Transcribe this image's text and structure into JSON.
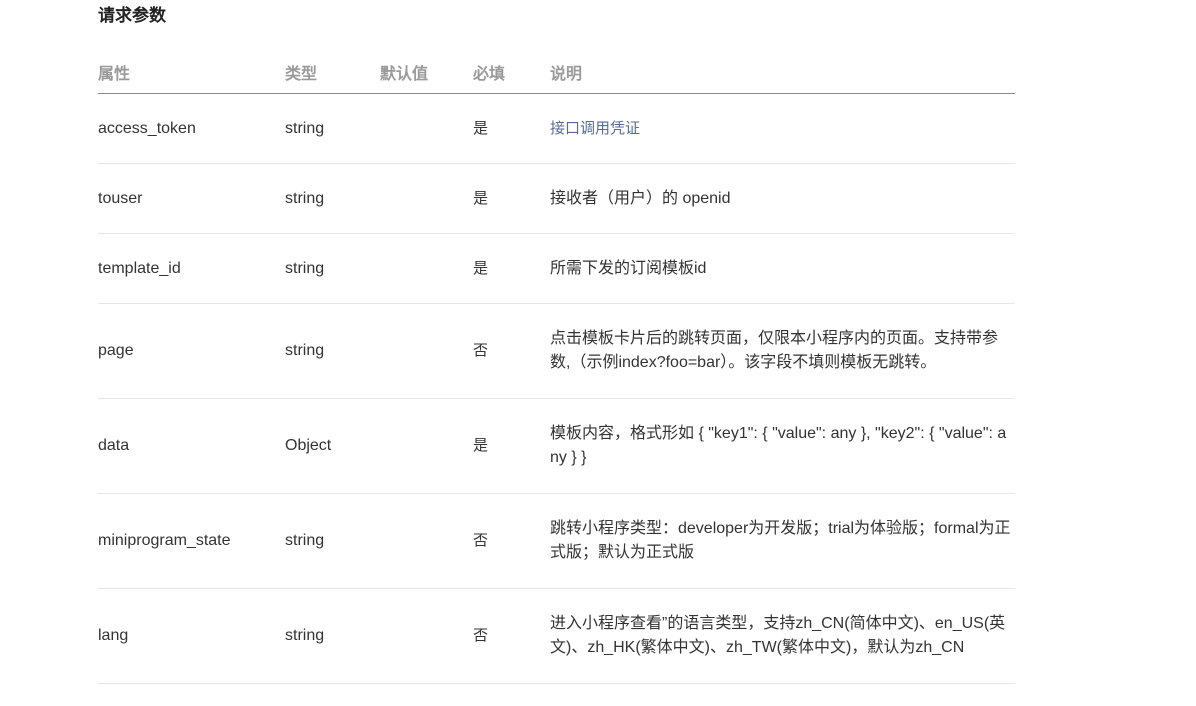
{
  "section": {
    "title": "请求参数"
  },
  "table": {
    "headers": {
      "name": "属性",
      "type": "类型",
      "default": "默认值",
      "required": "必填",
      "description": "说明"
    },
    "rows": [
      {
        "name": "access_token",
        "type": "string",
        "default": "",
        "required": "是",
        "description": "接口调用凭证"
      },
      {
        "name": "touser",
        "type": "string",
        "default": "",
        "required": "是",
        "description": "接收者（用户）的 openid"
      },
      {
        "name": "template_id",
        "type": "string",
        "default": "",
        "required": "是",
        "description": "所需下发的订阅模板id"
      },
      {
        "name": "page",
        "type": "string",
        "default": "",
        "required": "否",
        "description": "点击模板卡片后的跳转页面，仅限本小程序内的页面。支持带参数,（示例index?foo=bar）。该字段不填则模板无跳转。"
      },
      {
        "name": "data",
        "type": "Object",
        "default": "",
        "required": "是",
        "description": "模板内容，格式形如 { \"key1\": { \"value\": any }, \"key2\": { \"value\": any } }"
      },
      {
        "name": "miniprogram_state",
        "type": "string",
        "default": "",
        "required": "否",
        "description": "跳转小程序类型：developer为开发版；trial为体验版；formal为正式版；默认为正式版"
      },
      {
        "name": "lang",
        "type": "string",
        "default": "",
        "required": "否",
        "description": "进入小程序查看”的语言类型，支持zh_CN(简体中文)、en_US(英文)、zh_HK(繁体中文)、zh_TW(繁体中文)，默认为zh_CN"
      }
    ]
  }
}
